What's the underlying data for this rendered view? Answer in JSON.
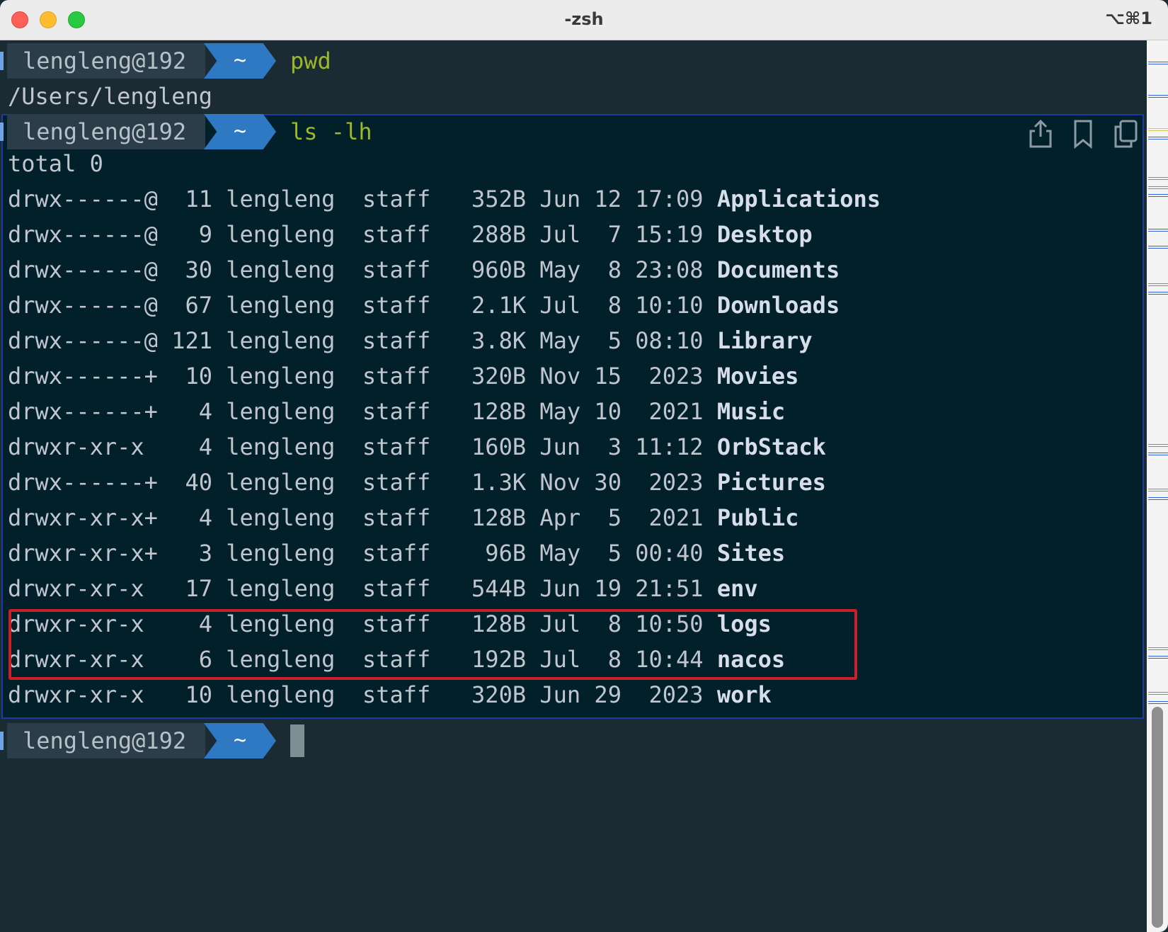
{
  "window": {
    "title": "-zsh",
    "shortcut": "⌥⌘1"
  },
  "prompt": {
    "user": "lengleng@192",
    "dir": "~"
  },
  "commands": {
    "first": "pwd",
    "second": "ls -lh"
  },
  "pwd_output": "/Users/lengleng",
  "ls_total": "total 0",
  "ls_rows": [
    {
      "meta": "drwx------@  11 lengleng  staff   352B Jun 12 17:09 ",
      "name": "Applications"
    },
    {
      "meta": "drwx------@   9 lengleng  staff   288B Jul  7 15:19 ",
      "name": "Desktop"
    },
    {
      "meta": "drwx------@  30 lengleng  staff   960B May  8 23:08 ",
      "name": "Documents"
    },
    {
      "meta": "drwx------@  67 lengleng  staff   2.1K Jul  8 10:10 ",
      "name": "Downloads"
    },
    {
      "meta": "drwx------@ 121 lengleng  staff   3.8K May  5 08:10 ",
      "name": "Library"
    },
    {
      "meta": "drwx------+  10 lengleng  staff   320B Nov 15  2023 ",
      "name": "Movies"
    },
    {
      "meta": "drwx------+   4 lengleng  staff   128B May 10  2021 ",
      "name": "Music"
    },
    {
      "meta": "drwxr-xr-x    4 lengleng  staff   160B Jun  3 11:12 ",
      "name": "OrbStack"
    },
    {
      "meta": "drwx------+  40 lengleng  staff   1.3K Nov 30  2023 ",
      "name": "Pictures"
    },
    {
      "meta": "drwxr-xr-x+   4 lengleng  staff   128B Apr  5  2021 ",
      "name": "Public"
    },
    {
      "meta": "drwxr-xr-x+   3 lengleng  staff    96B May  5 00:40 ",
      "name": "Sites"
    },
    {
      "meta": "drwxr-xr-x   17 lengleng  staff   544B Jun 19 21:51 ",
      "name": "env"
    },
    {
      "meta": "drwxr-xr-x    4 lengleng  staff   128B Jul  8 10:50 ",
      "name": "logs"
    },
    {
      "meta": "drwxr-xr-x    6 lengleng  staff   192B Jul  8 10:44 ",
      "name": "nacos"
    },
    {
      "meta": "drwxr-xr-x   10 lengleng  staff   320B Jun 29  2023 ",
      "name": "work"
    }
  ],
  "icons": {
    "share": "share-icon",
    "bookmark": "bookmark-icon",
    "copy": "copy-icon"
  },
  "colors": {
    "background": "#1b2b34",
    "block_background": "#012029",
    "prompt_dir": "#2f79c4",
    "command": "#9cb82a",
    "highlight_box": "#cc1f2a"
  }
}
